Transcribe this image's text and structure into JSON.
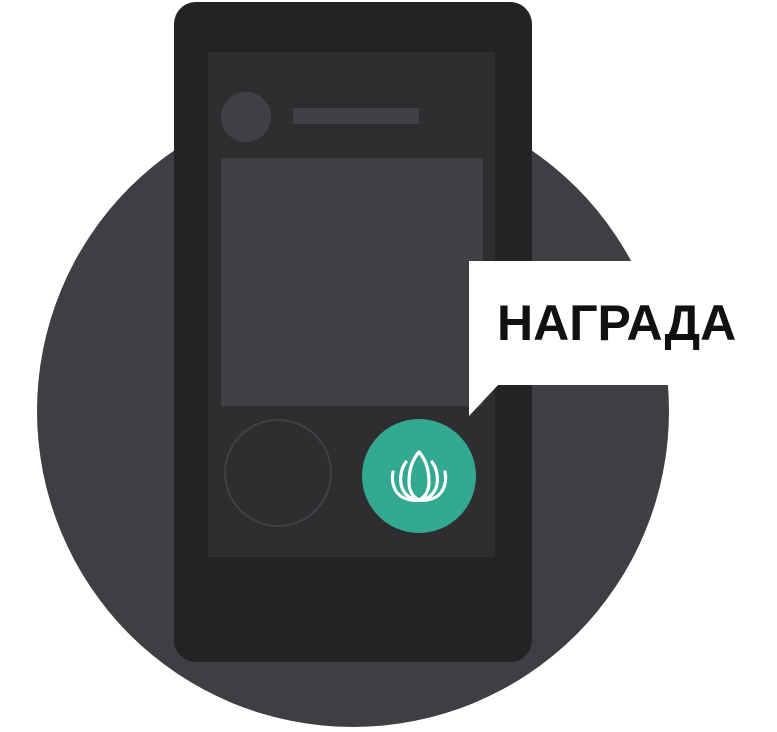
{
  "tooltip": {
    "label": "НАГРАДА"
  },
  "award_button": {
    "icon": "lotus-icon",
    "color": "#32a990"
  },
  "colors": {
    "background_circle": "#3f3f43",
    "phone_body": "#232325",
    "screen": "#2e2e31",
    "placeholder": "#414145",
    "tooltip": "#ffffff"
  }
}
